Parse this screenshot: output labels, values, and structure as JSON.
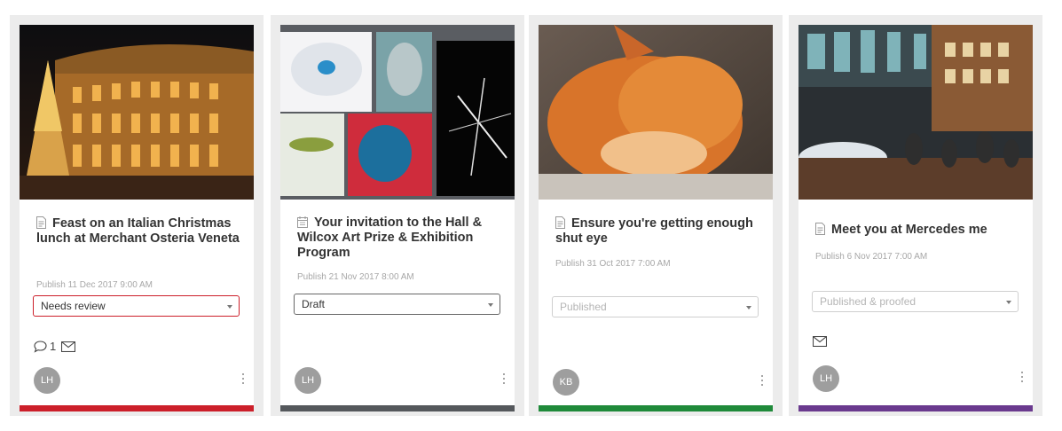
{
  "cards": [
    {
      "title": "Feast on an Italian Christmas lunch at Merchant Osteria Veneta",
      "title_icon": "document-icon",
      "publish": "Publish 11 Dec 2017 9:00 AM",
      "status": "Needs review",
      "comments_count": "1",
      "avatar": "LH",
      "bar_color": "#cc1f2a"
    },
    {
      "title": "Your invitation to the Hall & Wilcox Art Prize & Exhibition Program",
      "title_icon": "calendar-icon",
      "publish": "Publish 21 Nov 2017 8:00 AM",
      "status": "Draft",
      "avatar": "LH",
      "bar_color": "#55585c"
    },
    {
      "title": "Ensure you're getting enough shut eye",
      "title_icon": "document-icon",
      "publish": "Publish 31 Oct 2017 7:00 AM",
      "status": "Published",
      "avatar": "KB",
      "bar_color": "#1f8a3a"
    },
    {
      "title": "Meet you at Mercedes me",
      "title_icon": "document-icon",
      "publish": "Publish 6 Nov 2017 7:00 AM",
      "status": "Published & proofed",
      "avatar": "LH",
      "bar_color": "#6a3a8e"
    }
  ]
}
